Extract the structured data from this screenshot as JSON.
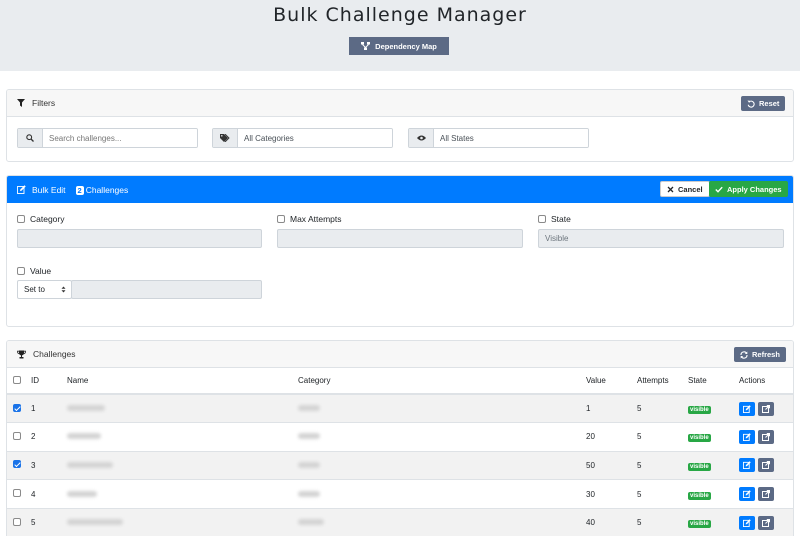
{
  "header": {
    "title": "Bulk Challenge Manager",
    "dependency_map_label": "Dependency Map"
  },
  "filters": {
    "title": "Filters",
    "reset_label": "Reset",
    "search_placeholder": "Search challenges...",
    "category_value": "All Categories",
    "state_value": "All States"
  },
  "bulk_edit": {
    "title": "Bulk Edit",
    "selected_count": "2",
    "count_suffix": "Challenges",
    "cancel_label": "Cancel",
    "apply_label": "Apply Changes",
    "category_label": "Category",
    "max_attempts_label": "Max Attempts",
    "state_label": "State",
    "state_placeholder": "Visible",
    "value_label": "Value",
    "value_mode": "Set to"
  },
  "challenges": {
    "title": "Challenges",
    "refresh_label": "Refresh",
    "columns": {
      "id": "ID",
      "name": "Name",
      "category": "Category",
      "value": "Value",
      "attempts": "Attempts",
      "state": "State",
      "actions": "Actions"
    },
    "rows": [
      {
        "checked": true,
        "id": "1",
        "value": "1",
        "attempts": "5",
        "state": "visible"
      },
      {
        "checked": false,
        "id": "2",
        "value": "20",
        "attempts": "5",
        "state": "visible"
      },
      {
        "checked": true,
        "id": "3",
        "value": "50",
        "attempts": "5",
        "state": "visible"
      },
      {
        "checked": false,
        "id": "4",
        "value": "30",
        "attempts": "5",
        "state": "visible"
      },
      {
        "checked": false,
        "id": "5",
        "value": "40",
        "attempts": "5",
        "state": "visible"
      }
    ]
  },
  "colors": {
    "primary": "#007bff",
    "secondary": "#5c6a85",
    "success": "#28a745",
    "jumbotron": "#e9ecef"
  },
  "icons": [
    "sitemap-icon",
    "filter-icon",
    "undo-icon",
    "search-icon",
    "tags-icon",
    "eye-icon",
    "edit-icon",
    "times-icon",
    "check-icon",
    "trophy-icon",
    "sync-icon",
    "external-link-icon"
  ]
}
